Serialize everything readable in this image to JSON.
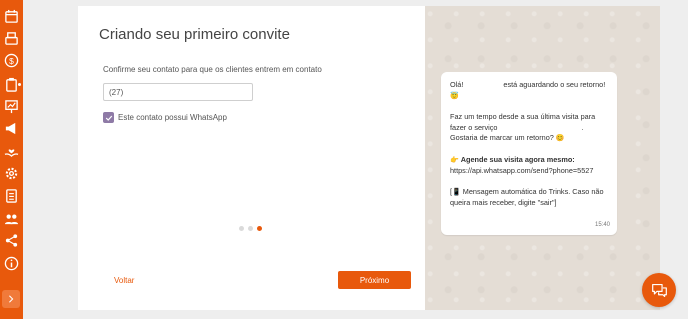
{
  "sidebar": {
    "icons": [
      "calendar-icon",
      "cash-register-icon",
      "dollar-icon",
      "clipboard-icon",
      "presentation-chart-icon",
      "megaphone-icon",
      "hand-heart-icon",
      "gear-icon",
      "checklist-icon",
      "users-icon",
      "share-icon",
      "info-icon"
    ],
    "expand": "chevron-right-icon"
  },
  "wizard": {
    "title": "Criando seu primeiro convite",
    "subtitle": "Confirme seu contato para que os clientes entrem em contato",
    "phone_value": "(27)",
    "whatsapp_label": "Este contato possui WhatsApp",
    "whatsapp_checked": true,
    "step_dots": [
      false,
      false,
      true
    ],
    "back_label": "Voltar",
    "next_label": "Próximo"
  },
  "preview": {
    "line1_a": "Olá!",
    "line1_b": "está aguardando o seu retorno!",
    "line1_emoji": "😇",
    "line2_a": "Faz um tempo desde a sua última visita para fazer o serviço",
    "line2_b": ". Gostaria de marcar um retorno?",
    "line2_emoji": "😊",
    "line3_emoji": "👉",
    "line3_bold": "Agende sua visita agora mesmo:",
    "line3_link": "https://api.whatsapp.com/send?phone=5527",
    "line4_prefix": "[",
    "line4_emoji": "📱",
    "line4_text": "Mensagem automática do Trinks. Caso não queira mais receber, digite \"sair\"]",
    "time": "15:40"
  },
  "fab": {
    "icon": "chat-bubbles-icon"
  },
  "colors": {
    "accent": "#e8590c",
    "checkbox": "#8e7aa6",
    "chat_bg": "#e4ddd5"
  }
}
